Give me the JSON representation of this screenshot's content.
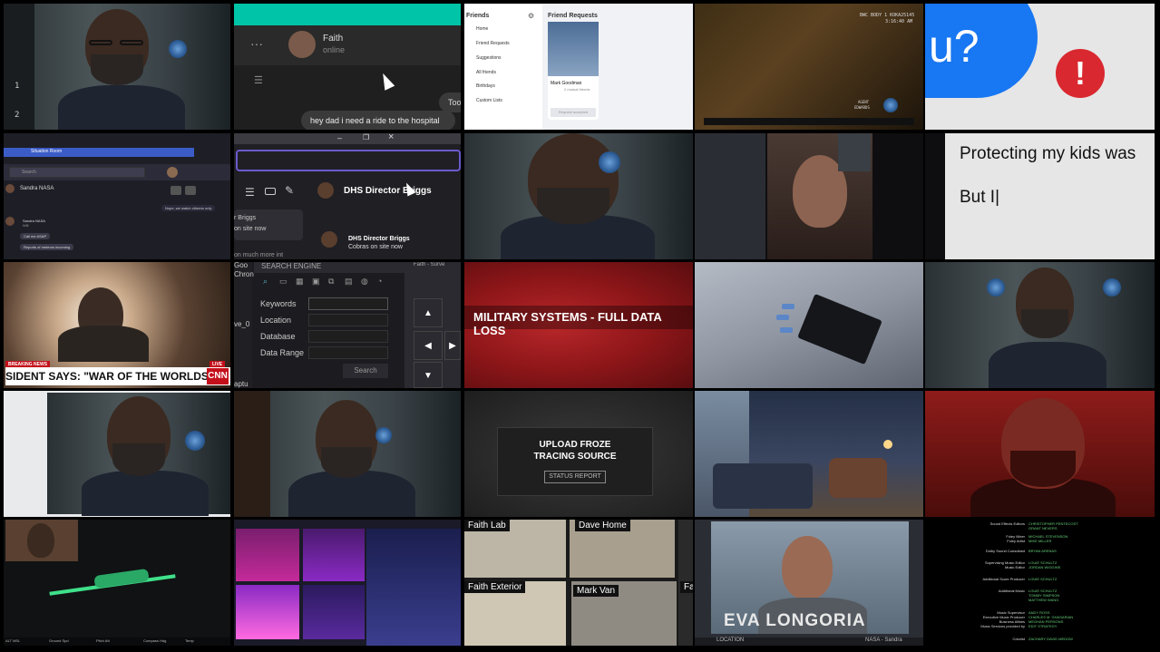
{
  "tiles": {
    "r1c1": {
      "counter_1": "1",
      "counter_2": "2"
    },
    "r1c2": {
      "contact_name": "Faith",
      "contact_status": "online",
      "message": "hey dad i need a ride to the hospital",
      "partial": "Too",
      "more_label": "···"
    },
    "r1c3": {
      "sidebar_title": "Friends",
      "items": [
        "Home",
        "Friend Requests",
        "Suggestions",
        "All friends",
        "Birthdays",
        "Custom Lists"
      ],
      "panel_title": "Friend Requests",
      "friend_name": "Mark Goodman",
      "friend_sub": "2 mutual friends",
      "request_status": "Request accepted"
    },
    "r1c4": {
      "cam_readout": "BWC BODY 1 KOKA25145",
      "cam_time": "3:16:40 AM",
      "agent_label": "AGENT",
      "agent_name": "EDWARDS"
    },
    "r1c5": {
      "big_text": "u?",
      "alert_glyph": "!"
    },
    "r2c1": {
      "window_title": "Situation Room",
      "search_placeholder": "Search",
      "contact_name": "Sandra NASA",
      "tooltip": "Nope, we watch citizens only",
      "msg_sender": "Sandra NASA",
      "msg_sub": "Will",
      "msg_1": "Call me ASAP",
      "msg_2": "Reports of meteors incoming"
    },
    "r2c2": {
      "contact_1": "DHS Director Briggs",
      "contact_2": "DHS Director Briggs",
      "contact_2_sub": "Cobras on site now",
      "left_name": "r Briggs",
      "left_sub": "on site now",
      "left_more": "on much more int"
    },
    "r2c5": {
      "line_1": "Protecting my kids was",
      "line_2": "But I|"
    },
    "r3c1": {
      "breaking_label": "BREAKING NEWS",
      "live_label": "LIVE",
      "ticker": "SIDENT SAYS:  \"WAR OF THE WORLDS",
      "network": "CNN"
    },
    "r3c2": {
      "engine_title": "SEARCH ENGINE",
      "left_partial_1": "Goo",
      "left_partial_2": "Chron",
      "left_partial_3": "ve_0",
      "left_partial_4": "aptu",
      "fields": [
        "Keywords",
        "Location",
        "Database",
        "Data Range"
      ],
      "search_button": "Search",
      "surv_label": "Faith - Surve"
    },
    "r3c3": {
      "banner": "MILITARY SYSTEMS - FULL DATA LOSS"
    },
    "r4c3": {
      "line_1": "UPLOAD FROZE",
      "line_2": "TRACING SOURCE",
      "button": "STATUS REPORT"
    },
    "r5c1": {
      "hud_left": "ALT MSL",
      "hud_1": "Ground Spd",
      "hud_2": "Pitch Att",
      "hud_3": "Compass Hdg",
      "hud_4": "Temp"
    },
    "r5c3": {
      "cam_1": "Faith Lab",
      "cam_2": "Dave Home",
      "cam_3": "Faith Exterior",
      "cam_4": "Mark Van",
      "cam_5": "Fai"
    },
    "r5c4": {
      "name_caption": "EVA LONGORIA",
      "location_label": "LOCATION",
      "call_label": "NASA - Sandra"
    },
    "r5c5": {
      "credits": [
        {
          "role": "Sound Effects Editors",
          "names": "CHRISTOPHER PENTECOST\nGRANT NEVERS"
        },
        {
          "role": "Foley Mixer\nFoley Artist",
          "names": "MICHAEL STEVENSON\nMIKE MILLER"
        },
        {
          "role": "Dolby Sound Consultant",
          "names": "BRYAN ARENAS"
        },
        {
          "role": "Supervising Music Editor\nMusic Editor",
          "names": "LOUIE SCHULTZ\nJORDAN WIGGINS"
        },
        {
          "role": "Additional Score Producer",
          "names": "LOUIE SCHULTZ"
        },
        {
          "role": "Additional Music",
          "names": "LOUIE SCHULTZ\nTOMMY SIMPSON\nMATTHEW WANG"
        },
        {
          "role": "Music Supervisor\nExecutive Music Producer\nBusiness Affairs\nMusic Services provided by",
          "names": "ANDY ROSS\nCHARLES M. GHASARIAN\nMEGHAN PERSONS\nEDIT STRATEGY"
        },
        {
          "role": "Colorist",
          "names": "ZACHARY DAVID MEDOW"
        }
      ]
    }
  },
  "colors": {
    "teal": "#00c4a7",
    "fb_blue": "#1877f2",
    "alert_red": "#d9282f",
    "map_red": "#9e1b1e",
    "credit_green": "#68d07b",
    "drone_green": "#3fe08a"
  }
}
